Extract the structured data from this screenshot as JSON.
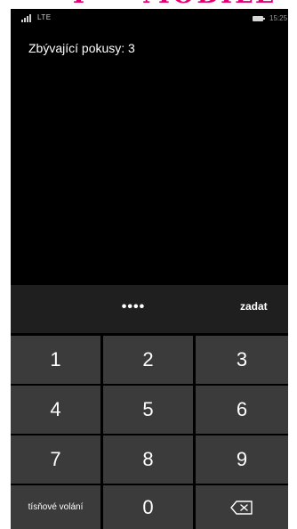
{
  "brand": {
    "word_left": "T",
    "word_right": "MOBILE",
    "color": "#e20074"
  },
  "status_bar": {
    "network": "LTE",
    "time": "15:25",
    "signal_icon": "signal-icon",
    "battery_icon": "battery-icon"
  },
  "prompt": {
    "attempts_text": "Zbývající pokusy: 3"
  },
  "entry": {
    "masked_pin": "••••",
    "enter_label": "zadat"
  },
  "keypad": {
    "keys": [
      {
        "label": "1"
      },
      {
        "label": "2"
      },
      {
        "label": "3"
      },
      {
        "label": "4"
      },
      {
        "label": "5"
      },
      {
        "label": "6"
      },
      {
        "label": "7"
      },
      {
        "label": "8"
      },
      {
        "label": "9"
      }
    ],
    "emergency_label": "tísňové volání",
    "zero_label": "0",
    "backspace_icon": "backspace-icon"
  },
  "colors": {
    "screen_bg": "#000000",
    "entry_bg": "#1f1f1f",
    "key_bg": "#3b3b3b",
    "text": "#ffffff"
  }
}
